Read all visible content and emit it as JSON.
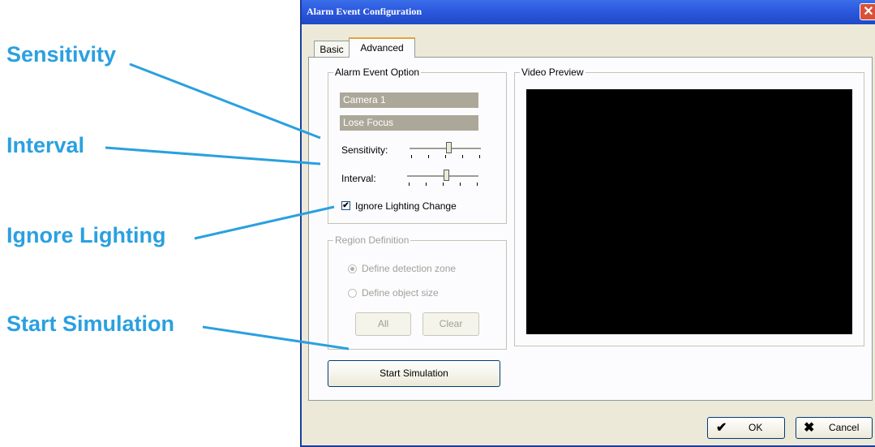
{
  "callouts": {
    "sensitivity": "Sensitivity",
    "interval": "Interval",
    "ignore_lighting": "Ignore Lighting",
    "start_simulation": "Start Simulation"
  },
  "dialog": {
    "title": "Alarm Event Configuration",
    "close_glyph": "✕"
  },
  "tabs": [
    {
      "label": "Basic",
      "active": false
    },
    {
      "label": "Advanced",
      "active": true
    }
  ],
  "alarm_event_option": {
    "label": "Alarm Event Option",
    "camera_field": "Camera 1",
    "event_field": "Lose Focus",
    "sensitivity_label": "Sensitivity:",
    "sensitivity_level": 0.55,
    "interval_label": "Interval:",
    "interval_level": 0.55,
    "ignore_lighting_label": "Ignore Lighting Change",
    "ignore_lighting_checked": true
  },
  "region_definition": {
    "label": "Region Definition",
    "detection_zone_label": "Define detection zone",
    "object_size_label": "Define object size",
    "all_button": "All",
    "clear_button": "Clear"
  },
  "start_simulation_button": "Start Simulation",
  "video_preview": {
    "label": "Video Preview"
  },
  "footer": {
    "ok_label": "OK",
    "cancel_label": "Cancel"
  },
  "colors": {
    "callout": "#2aa0e0",
    "title_bar": "#2d5be0",
    "dialog_bg": "#ece9d8"
  }
}
